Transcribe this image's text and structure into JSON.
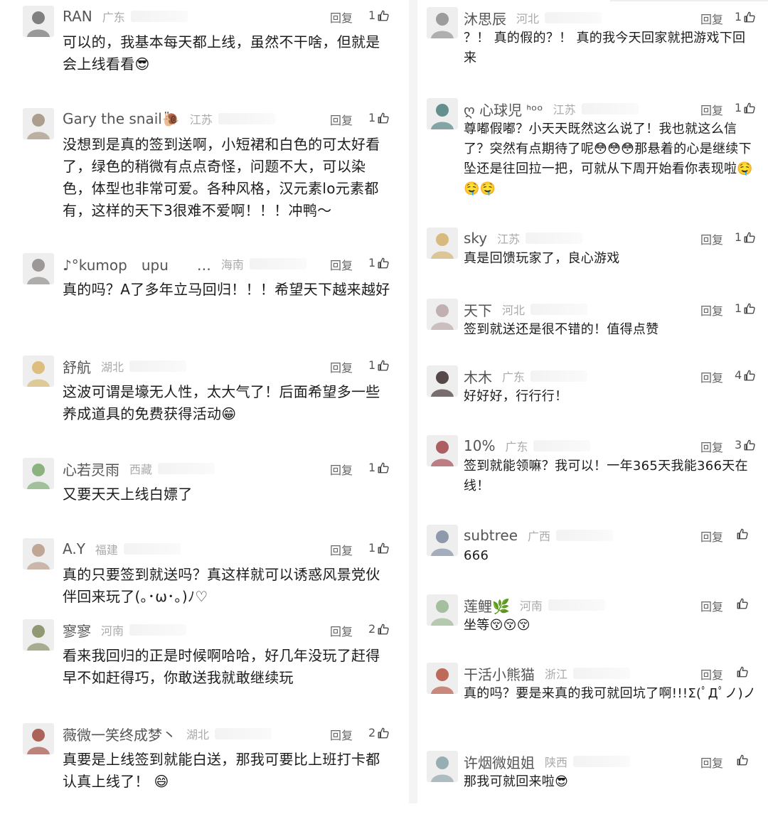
{
  "left": [
    {
      "name": "RAN",
      "region": "广东",
      "reply": "回复",
      "likes": "1",
      "text": "可以的，我基本每天都上线，虽然不干啥，但就是会上线看看😎"
    },
    {
      "name": "Gary the snail🐌",
      "region": "江苏",
      "reply": "回复",
      "likes": "1",
      "text": "没想到是真的签到送啊，小短裙和白色的可太好看了，绿色的稍微有点点奇怪，问题不大，可以染色，体型也非常可爱。各种风格，汉元素lo元素都有，这样的天下3很难不爱啊！！！冲鸭～"
    },
    {
      "name": "♪°kumop　upu　　…",
      "region": "海南",
      "reply": "回复",
      "likes": "1",
      "text": "真的吗？A了多年立马回归！！！希望天下越来越好"
    },
    {
      "name": "舒航",
      "region": "湖北",
      "reply": "回复",
      "likes": "1",
      "text": "这波可谓是壕无人性，太大气了！后面希望多一些养成道具的免费获得活动😁"
    },
    {
      "name": "心若灵雨",
      "region": "西藏",
      "reply": "回复",
      "likes": "1",
      "text": "又要天天上线白嫖了"
    },
    {
      "name": "A.Y",
      "region": "福建",
      "reply": "回复",
      "likes": "1",
      "text": "真的只要签到就送吗？真这样就可以诱惑风景党伙伴回来玩了(｡･ω･｡)ﾉ♡"
    },
    {
      "name": "寥寥",
      "region": "河南",
      "reply": "回复",
      "likes": "2",
      "text": "看来我回归的正是时候啊哈哈，好几年没玩了赶得早不如赶得巧，你敢送我就敢继续玩"
    },
    {
      "name": "薇微一笑终成梦丶",
      "region": "湖北",
      "reply": "回复",
      "likes": "2",
      "text": "真要是上线签到就能白送，那我可要比上班打卡都认真上线了！ 😄"
    }
  ],
  "right": [
    {
      "name": "沐思辰",
      "region": "河北",
      "reply": "回复",
      "likes": "1",
      "text": "？！ 真的假的？！ 真的我今天回家就把游戏下回来"
    },
    {
      "name": "ღ 心球児 ᑋᵒᵒ",
      "region": "江苏",
      "reply": "回复",
      "likes": "1",
      "text": "尊嘟假嘟？小天天既然这么说了！我也就这么信了？突然有点期待了呢😳😳😳那悬着的心是继续下坠还是往回拉一把，可就从下周开始看你表现啦🤤🤤🤤"
    },
    {
      "name": "sky",
      "region": "江苏",
      "reply": "回复",
      "likes": "1",
      "text": "真是回馈玩家了，良心游戏"
    },
    {
      "name": "天下",
      "region": "河北",
      "reply": "回复",
      "likes": "1",
      "text": "签到就送还是很不错的！值得点赞"
    },
    {
      "name": "木木",
      "region": "广东",
      "reply": "回复",
      "likes": "4",
      "text": "好好好，行行行！"
    },
    {
      "name": "10%",
      "region": "广东",
      "reply": "回复",
      "likes": "3",
      "text": "签到就能领嘛？我可以！一年365天我能366天在线！"
    },
    {
      "name": "subtree",
      "region": "广西",
      "reply": "回复",
      "likes": "",
      "text": "666"
    },
    {
      "name": "莲鲤🌿",
      "region": "河南",
      "reply": "回复",
      "likes": "",
      "text": "坐等😚😚😚"
    },
    {
      "name": "干活小熊猫",
      "region": "浙江",
      "reply": "回复",
      "likes": "",
      "text": "真的吗？要是来真的我可就回坑了啊!!!Σ(ﾟДﾟノ)ノ"
    },
    {
      "name": "许烟微姐姐",
      "region": "陕西",
      "reply": "回复",
      "likes": "",
      "text": "那我可就回来啦😎"
    }
  ]
}
